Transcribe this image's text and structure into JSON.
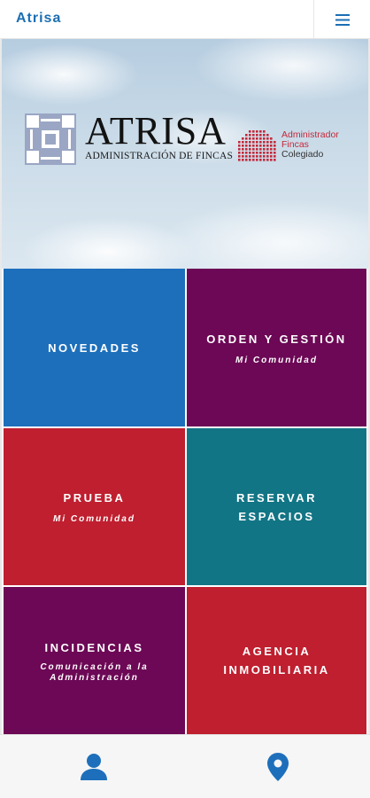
{
  "app": {
    "title": "Atrisa"
  },
  "banner": {
    "brand": "ATRISA",
    "brand_subtitle": "ADMINISTRACIÓN DE FINCAS",
    "seal_lines": [
      "Administrador",
      "Fincas",
      "Colegiado"
    ]
  },
  "tiles": [
    {
      "title": "NOVEDADES",
      "subtitle": "",
      "color": "#1d6fbb"
    },
    {
      "title": "ORDEN Y GESTIÓN",
      "subtitle": "Mi Comunidad",
      "color": "#6c0855"
    },
    {
      "title": "PRUEBA",
      "subtitle": "Mi Comunidad",
      "color": "#bf1f2f"
    },
    {
      "title": "RESERVAR\nESPACIOS",
      "subtitle": "",
      "color": "#127585"
    },
    {
      "title": "INCIDENCIAS",
      "subtitle": "Comunicación a la\nAdministración",
      "color": "#6c0855"
    },
    {
      "title": "AGENCIA\nINMOBILIARIA",
      "subtitle": "",
      "color": "#bf1f2f"
    }
  ],
  "bottom_nav": {
    "items": [
      {
        "icon": "user-icon",
        "color": "#1d6fbb"
      },
      {
        "icon": "location-pin-icon",
        "color": "#1d6fbb"
      }
    ]
  },
  "colors": {
    "accent": "#1c6fb3",
    "logo_blue": "#9aa6c4",
    "seal_red": "#c4283a"
  }
}
